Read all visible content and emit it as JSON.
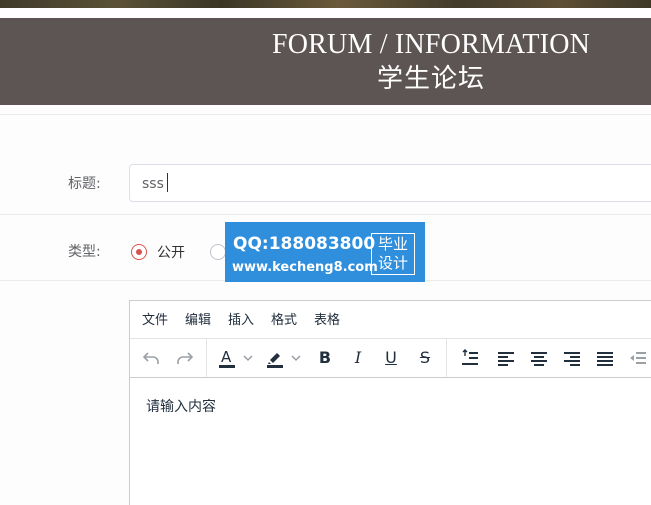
{
  "banner": {
    "title": "FORUM / INFORMATION",
    "subtitle": "学生论坛"
  },
  "form": {
    "title_label": "标题:",
    "title_value": "sss",
    "type_label": "类型:",
    "type_options": [
      {
        "label": "公开",
        "selected": true
      },
      {
        "label": "",
        "selected": false
      }
    ]
  },
  "watermark": {
    "qq": "QQ:188083800",
    "site": "www.kecheng8.com",
    "tag_line1": "毕业",
    "tag_line2": "设计"
  },
  "editor": {
    "menus": [
      "文件",
      "编辑",
      "插入",
      "格式",
      "表格"
    ],
    "toolbar_icons": [
      "undo-icon",
      "redo-icon",
      "text-color-icon",
      "highlight-icon",
      "bold-icon",
      "italic-icon",
      "underline-icon",
      "strikethrough-icon",
      "line-height-icon",
      "align-left-icon",
      "align-center-icon",
      "align-right-icon",
      "align-justify-icon",
      "outdent-icon"
    ],
    "placeholder": "请输入内容"
  },
  "colors": {
    "banner_bg": "#5c5553",
    "accent_radio": "#d9534f",
    "watermark_bg": "#2f8fdc"
  }
}
